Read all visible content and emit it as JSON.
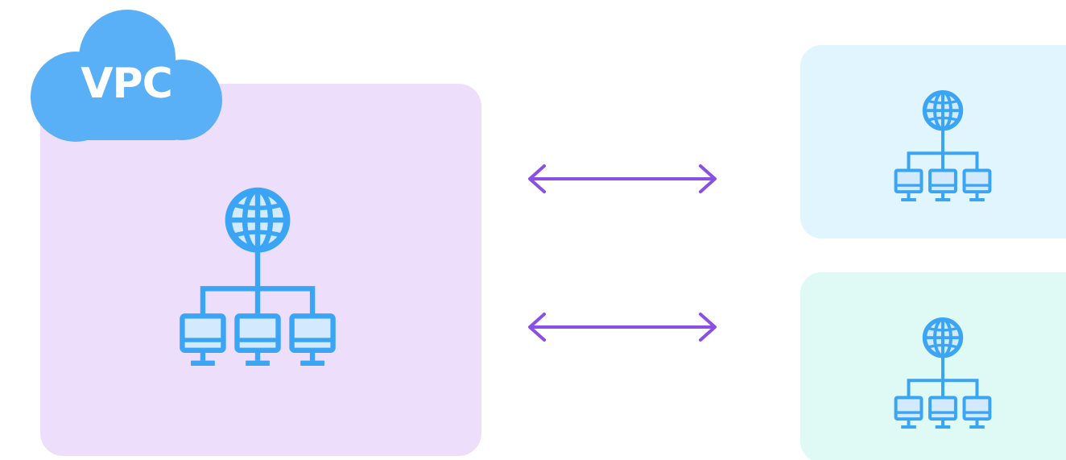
{
  "vpc": {
    "label": "VPC",
    "box_color": "#eddffc",
    "cloud_color": "#59b0f7"
  },
  "remote_networks": [
    {
      "box_color": "#e0f5fd"
    },
    {
      "box_color": "#dffaf5"
    }
  ],
  "connections": [
    {
      "type": "bidirectional-arrow",
      "color": "#8a4fe3"
    },
    {
      "type": "bidirectional-arrow",
      "color": "#8a4fe3"
    }
  ],
  "icon": {
    "name": "network-globe-icon",
    "color": "#3aa4f5"
  }
}
